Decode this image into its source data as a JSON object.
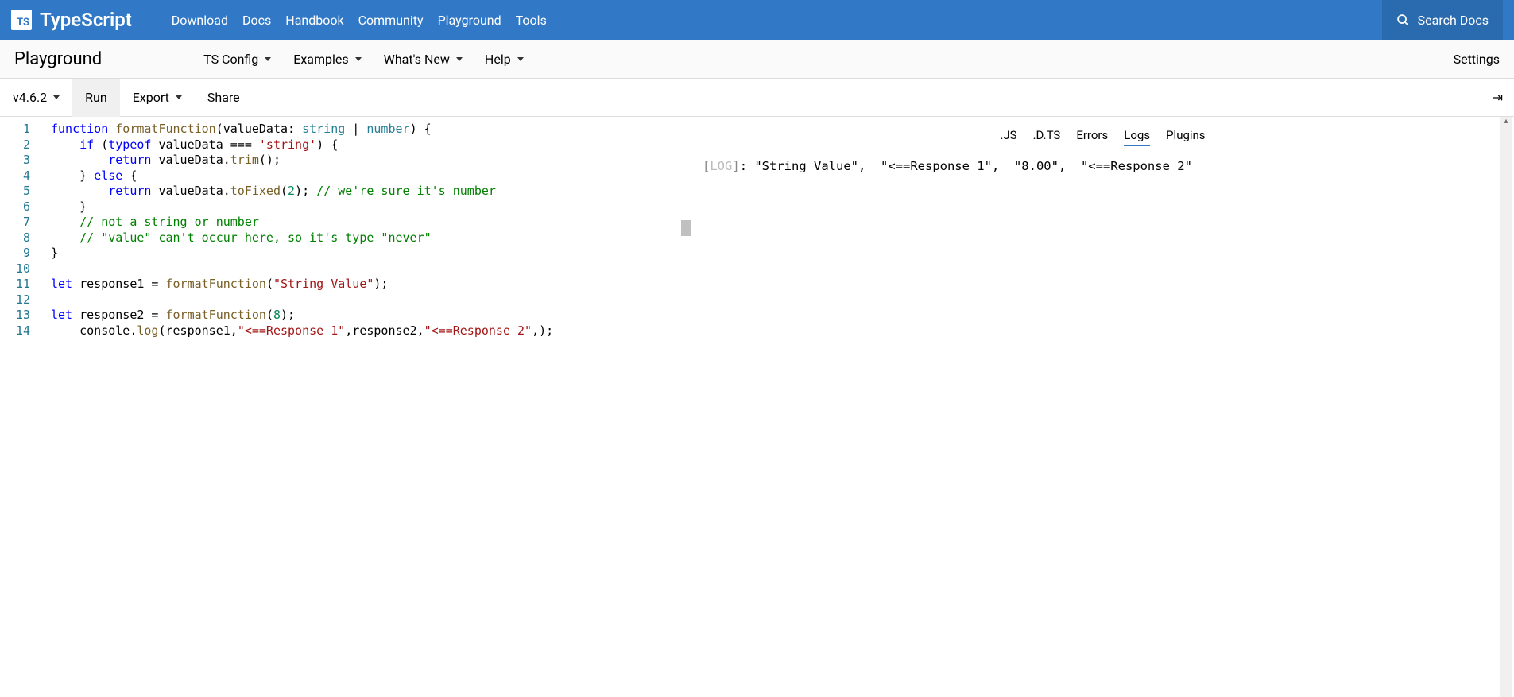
{
  "header": {
    "logo_short": "TS",
    "logo_text": "TypeScript",
    "nav": [
      "Download",
      "Docs",
      "Handbook",
      "Community",
      "Playground",
      "Tools"
    ],
    "search_label": "Search Docs"
  },
  "subheader": {
    "title": "Playground",
    "nav": [
      "TS Config",
      "Examples",
      "What's New",
      "Help"
    ],
    "settings": "Settings"
  },
  "toolbar": {
    "version": "v4.6.2",
    "run": "Run",
    "export": "Export",
    "share": "Share",
    "arrow": "⇥"
  },
  "editor": {
    "line_count": 14,
    "code_tokens": [
      [
        [
          "kw",
          "function"
        ],
        [
          "",
          " "
        ],
        [
          "fn",
          "formatFunction"
        ],
        [
          "",
          "(valueData: "
        ],
        [
          "typ",
          "string"
        ],
        [
          "",
          " | "
        ],
        [
          "typ",
          "number"
        ],
        [
          "",
          ") {"
        ]
      ],
      [
        [
          "",
          "    "
        ],
        [
          "kw",
          "if"
        ],
        [
          "",
          " ("
        ],
        [
          "kw",
          "typeof"
        ],
        [
          "",
          " valueData === "
        ],
        [
          "str",
          "'string'"
        ],
        [
          "",
          ") {"
        ]
      ],
      [
        [
          "",
          "        "
        ],
        [
          "kw",
          "return"
        ],
        [
          "",
          " valueData."
        ],
        [
          "fn",
          "trim"
        ],
        [
          "",
          "();"
        ]
      ],
      [
        [
          "",
          "    } "
        ],
        [
          "kw",
          "else"
        ],
        [
          "",
          " {"
        ]
      ],
      [
        [
          "",
          "        "
        ],
        [
          "kw",
          "return"
        ],
        [
          "",
          " valueData."
        ],
        [
          "fn",
          "toFixed"
        ],
        [
          "",
          "("
        ],
        [
          "num",
          "2"
        ],
        [
          "",
          "); "
        ],
        [
          "com",
          "// we're sure it's number"
        ]
      ],
      [
        [
          "",
          "    }"
        ]
      ],
      [
        [
          "",
          "    "
        ],
        [
          "com",
          "// not a string or number"
        ]
      ],
      [
        [
          "",
          "    "
        ],
        [
          "com",
          "// \"value\" can't occur here, so it's type \"never\""
        ]
      ],
      [
        [
          "",
          "}"
        ]
      ],
      [
        [
          "",
          ""
        ]
      ],
      [
        [
          "kw",
          "let"
        ],
        [
          "",
          " response1 = "
        ],
        [
          "fn",
          "formatFunction"
        ],
        [
          "",
          "("
        ],
        [
          "str",
          "\"String Value\""
        ],
        [
          "",
          ");"
        ]
      ],
      [
        [
          "",
          ""
        ]
      ],
      [
        [
          "kw",
          "let"
        ],
        [
          "",
          " response2 = "
        ],
        [
          "fn",
          "formatFunction"
        ],
        [
          "",
          "("
        ],
        [
          "num",
          "8"
        ],
        [
          "",
          ");"
        ]
      ],
      [
        [
          "",
          "    console."
        ],
        [
          "fn",
          "log"
        ],
        [
          "",
          "(response1,"
        ],
        [
          "str",
          "\"<==Response 1\""
        ],
        [
          "",
          ",response2,"
        ],
        [
          "str",
          "\"<==Response 2\""
        ],
        [
          "",
          ",);"
        ]
      ]
    ]
  },
  "output": {
    "tabs": [
      ".JS",
      ".D.TS",
      "Errors",
      "Logs",
      "Plugins"
    ],
    "active_tab": "Logs",
    "log_prefix": "[LOG]",
    "log_line": ": \"String Value\",  \"<==Response 1\",  \"8.00\",  \"<==Response 2\" "
  }
}
